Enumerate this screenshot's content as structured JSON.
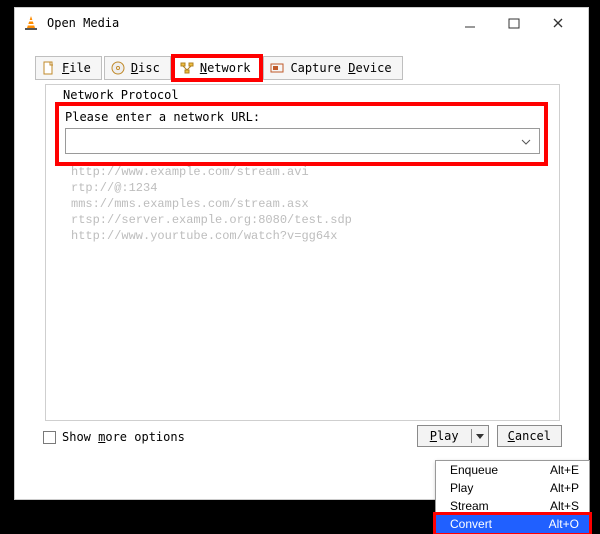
{
  "window": {
    "title": "Open Media"
  },
  "tabs": {
    "file": {
      "pre": "",
      "u": "F",
      "post": "ile"
    },
    "disc": {
      "pre": "",
      "u": "D",
      "post": "isc"
    },
    "network": {
      "pre": "",
      "u": "N",
      "post": "etwork"
    },
    "capture": {
      "pre": "Capture ",
      "u": "D",
      "post": "evice"
    }
  },
  "fieldset": {
    "label": "Network Protocol"
  },
  "url": {
    "label": "Please enter a network URL:",
    "value": ""
  },
  "examples": {
    "l1": "http://www.example.com/stream.avi",
    "l2": "rtp://@:1234",
    "l3": "mms://mms.examples.com/stream.asx",
    "l4": "rtsp://server.example.org:8080/test.sdp",
    "l5": "http://www.yourtube.com/watch?v=gg64x"
  },
  "show_more": {
    "pre": "Show ",
    "u": "m",
    "post": "ore options",
    "checked": false
  },
  "buttons": {
    "play": {
      "u": "P",
      "post": "lay"
    },
    "cancel": {
      "u": "C",
      "post": "ancel"
    }
  },
  "menu": {
    "items": [
      {
        "label": "Enqueue",
        "shortcut": "Alt+E"
      },
      {
        "label": "Play",
        "shortcut": "Alt+P"
      },
      {
        "label": "Stream",
        "shortcut": "Alt+S"
      }
    ],
    "convert": {
      "label": "Convert",
      "shortcut": "Alt+O"
    }
  }
}
